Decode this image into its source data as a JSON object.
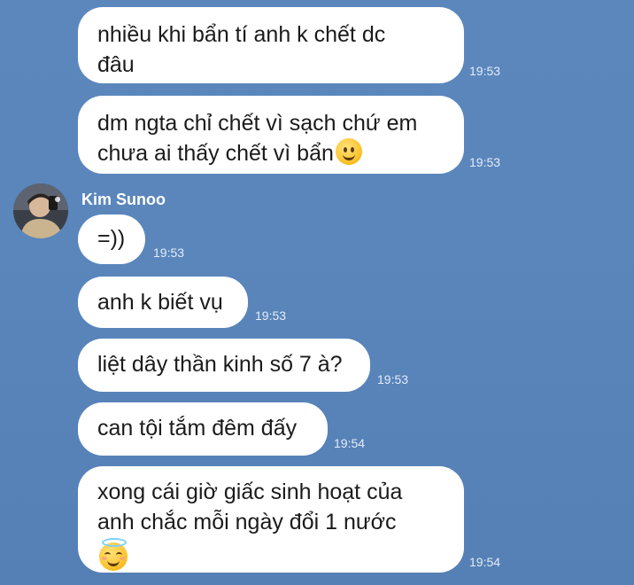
{
  "messages": [
    {
      "lines": [
        "nhiều khi bẩn tí anh k chết dc",
        "đâu"
      ],
      "time": "19:53"
    },
    {
      "lines": [
        "dm ngta chỉ chết vì sạch chứ em",
        "chưa ai thấy chết vì bẩn"
      ],
      "emoji": "slightly-smiling-face",
      "time": "19:53"
    },
    {
      "sender": "Kim Sunoo",
      "lines": [
        "=))"
      ],
      "time": "19:53"
    },
    {
      "lines": [
        "anh k biết vụ"
      ],
      "time": "19:53"
    },
    {
      "lines": [
        "liệt dây thần kinh số 7 à?"
      ],
      "time": "19:53"
    },
    {
      "lines": [
        "can tội tắm đêm đấy"
      ],
      "time": "19:54"
    },
    {
      "lines": [
        "xong cái giờ giấc sinh hoạt của",
        "anh chắc mỗi ngày đổi 1 nước"
      ],
      "emoji": "smiling-face-with-halo",
      "time": "19:54"
    }
  ],
  "colors": {
    "background": "#5a86bc",
    "bubble": "#ffffff",
    "sender": "#ffffff",
    "timestamp": "#e3ecf7"
  }
}
